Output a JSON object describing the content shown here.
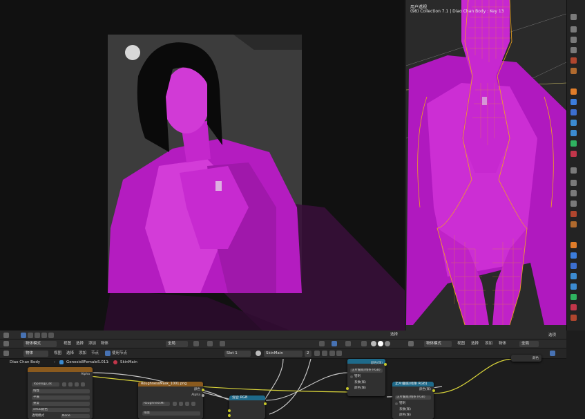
{
  "viewport_right": {
    "title": "用户透视",
    "subtitle": "(98) Collection 7.1 | Diao Chan Body : Key 13"
  },
  "viewport_footer": {
    "select_label": "选择"
  },
  "header_left": {
    "mode": "物体模式",
    "menu": [
      "视图",
      "选择",
      "添加",
      "物体"
    ],
    "transform": "全局"
  },
  "header_right": {
    "mode": "物体模式",
    "menu": [
      "视图",
      "选择",
      "添加",
      "物体"
    ],
    "transform": "全局",
    "select_label": "选项"
  },
  "node_header": {
    "type": "物体",
    "menu": [
      "视图",
      "选择",
      "添加",
      "节点"
    ],
    "use_nodes": "使用节点",
    "slot": "Slot 1",
    "material": "SkinMain",
    "users": "2"
  },
  "breadcrumb": {
    "object": "Diao Chan Body",
    "mesh": "Genesis8FemaleS.011",
    "material": "SkinMain"
  },
  "nodes": {
    "texture1": {
      "image": "Topology_sk",
      "rows": [
        "线性",
        "平展",
        "重复",
        "sRGB颜色"
      ],
      "alpha_label": "Alpha",
      "alpha_value": "None",
      "alpha_field": "透明模式"
    },
    "texture2": {
      "title": "RoughnessMask_1001.png",
      "out_color": "颜色",
      "out_alpha": "Alpha",
      "image": "RoughnessMi",
      "row": "线性"
    },
    "mix1": {
      "title": "混合 RGB"
    },
    "shader1": {
      "rows": [
        "颜色(辉)",
        "正片叠底(线条 RGB)",
        "钳制",
        "系数(辉)",
        "颜色(辉)"
      ]
    },
    "shader2": {
      "title": "正片叠底(线条 RGB)",
      "rows": [
        "颜色(辉)",
        "正片叠底(线条 RGB)",
        "钳制",
        "系数(辉)",
        "颜色(辉)"
      ]
    },
    "right_node": {
      "out": "颜色"
    }
  },
  "colors": {
    "magenta": "#c21cc8",
    "wire": "#f2a51c",
    "accent_blue": "#4772b3",
    "node_teal": "#1e6a8a",
    "node_orange": "#8a5a1e"
  }
}
